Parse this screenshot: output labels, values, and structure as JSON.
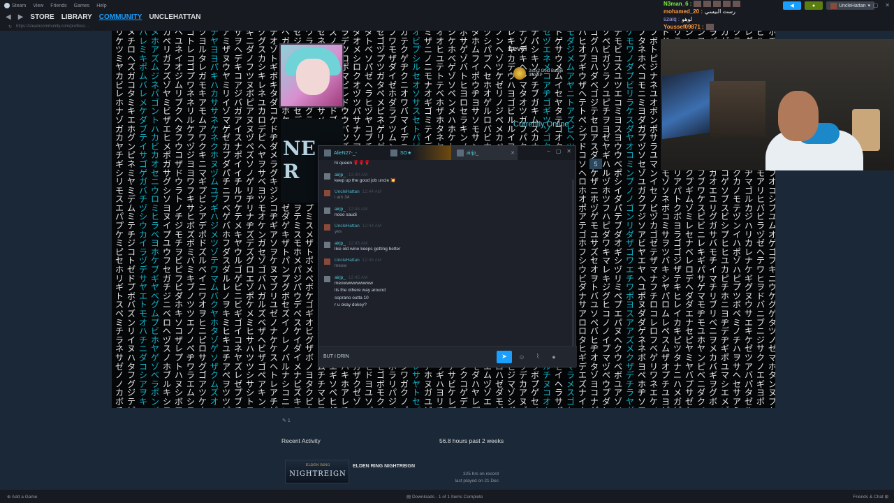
{
  "menu": {
    "app_name": "Steam",
    "items": [
      "View",
      "Friends",
      "Games",
      "Help"
    ]
  },
  "nav": {
    "store": "STORE",
    "library": "LIBRARY",
    "community": "COMMUNITY",
    "user": "UNCLEHATTAN"
  },
  "topbar": {
    "username": "UncleHattan"
  },
  "stream_chat": [
    {
      "name": "N3man_6 :",
      "text": ""
    },
    {
      "name": "mohamed_20 :",
      "text": "رست البيسي"
    },
    {
      "name": "szaiq :",
      "text": "لوهو"
    },
    {
      "name": "Youssef09871 :",
      "text": ""
    }
  ],
  "profile": {
    "level_label": "Level",
    "badge_name": "2x2x2 Gold Badge",
    "badge_xp": "300 XP",
    "currently_online": "Currently Online",
    "friend_count": "5"
  },
  "chat": {
    "tabs": [
      {
        "name": "AlieN27-_-"
      },
      {
        "name": "SO★"
      },
      {
        "name": "airjp_"
      }
    ],
    "messages": [
      {
        "user": "",
        "time": "",
        "lines": [
          "hi queen 🌹🌹🌹"
        ],
        "self": false,
        "partial": true
      },
      {
        "user": "airjp_",
        "time": "12:40 AM",
        "lines": [
          "keep up the good job uncle 💥"
        ],
        "self": false
      },
      {
        "user": "UncleHattan",
        "time": "12:44 AM",
        "lines": [
          "i am 34"
        ],
        "self": true
      },
      {
        "user": "airjp_",
        "time": "12:44 AM",
        "lines": [
          "nooo saudi"
        ],
        "self": false
      },
      {
        "user": "UncleHattan",
        "time": "12:44 AM",
        "lines": [
          "yes"
        ],
        "self": true
      },
      {
        "user": "airjp_",
        "time": "12:45 AM",
        "lines": [
          "like old wine keeps getting better"
        ],
        "self": false
      },
      {
        "user": "UncleHattan",
        "time": "12:45 AM",
        "lines": [
          "meow"
        ],
        "self": true
      },
      {
        "user": "airjp_",
        "time": "12:45 AM",
        "lines": [
          "meowwwwwwwww",
          "its the othere way around",
          "soprano outta 10",
          "r u okay dokey?"
        ],
        "self": false
      }
    ],
    "input_value": "BUT I DRIN"
  },
  "activity": {
    "recent_label": "Recent Activity",
    "hours_summary": "56.8 hours past 2 weeks",
    "game_caption_top": "ELDEN RING",
    "game_caption_main": "NIGHTREIGN",
    "game_title": "ELDEN RING NIGHTREIGN",
    "hrs_on_record": "325 hrs on record",
    "last_played": "last played on 21 Dec",
    "comment_count": "1"
  },
  "bottom": {
    "add_game": "Add a Game",
    "downloads": "Downloads - 1 of 1 Items Complete",
    "friends_chat": "Friends & Chat"
  }
}
